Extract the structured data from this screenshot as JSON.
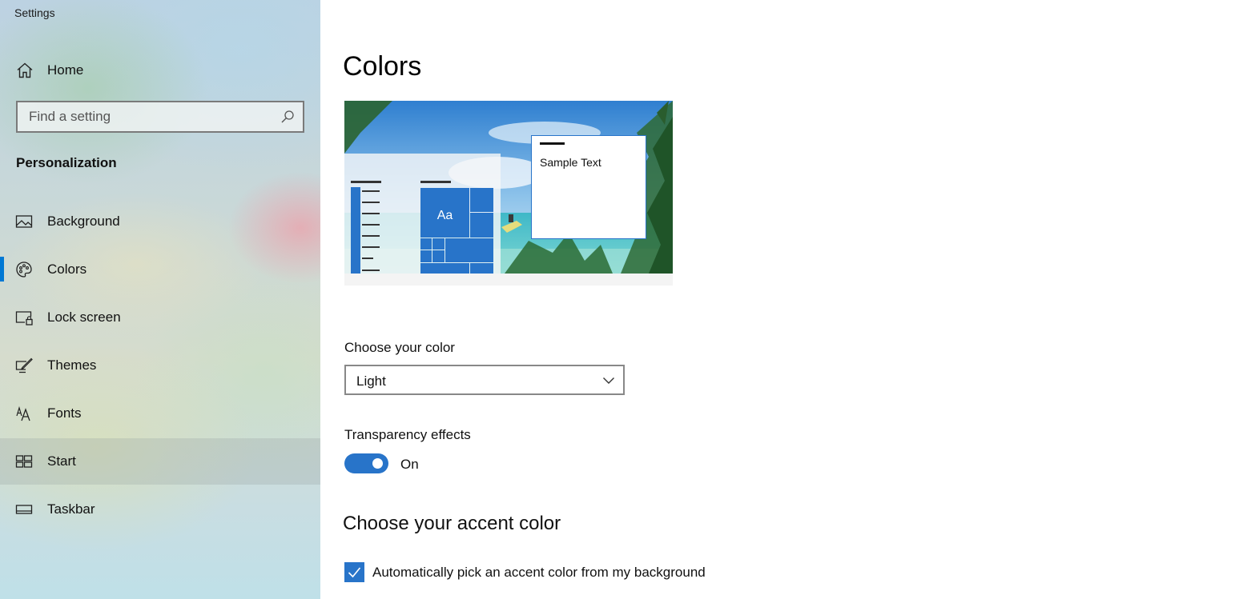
{
  "window": {
    "title": "Settings"
  },
  "sidebar": {
    "home_label": "Home",
    "search_placeholder": "Find a setting",
    "section_label": "Personalization",
    "items": [
      {
        "label": "Background",
        "icon": "picture-icon"
      },
      {
        "label": "Colors",
        "icon": "palette-icon",
        "selected": true
      },
      {
        "label": "Lock screen",
        "icon": "lock-screen-icon"
      },
      {
        "label": "Themes",
        "icon": "themes-icon"
      },
      {
        "label": "Fonts",
        "icon": "fonts-icon"
      },
      {
        "label": "Start",
        "icon": "start-icon",
        "hover": true
      },
      {
        "label": "Taskbar",
        "icon": "taskbar-icon"
      }
    ]
  },
  "main": {
    "title": "Colors",
    "preview": {
      "sample_text": "Sample Text",
      "tile_text": "Aa"
    },
    "choose_color": {
      "label": "Choose your color",
      "selected": "Light"
    },
    "transparency": {
      "label": "Transparency effects",
      "state": "On",
      "enabled": true
    },
    "accent": {
      "heading": "Choose your accent color",
      "auto_pick_label": "Automatically pick an accent color from my background",
      "auto_pick_checked": true
    }
  },
  "colors": {
    "accent": "#2874c9",
    "selected_indicator": "#0078d4"
  }
}
